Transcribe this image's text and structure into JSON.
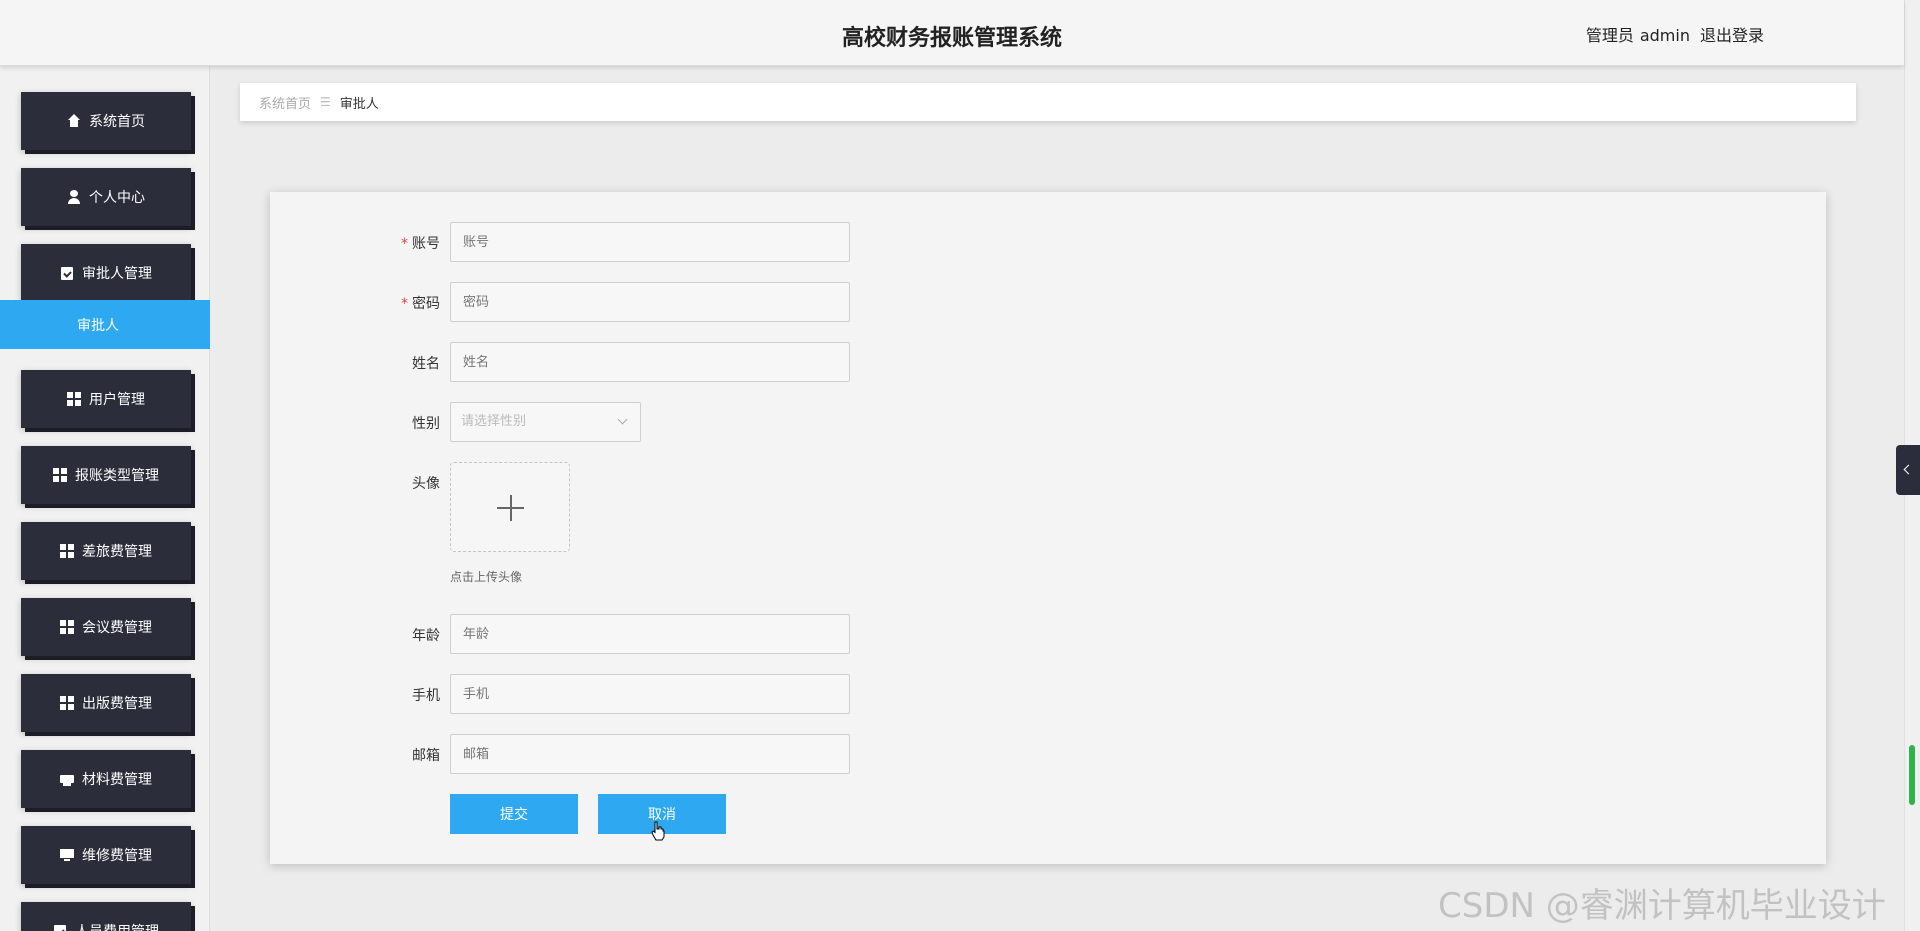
{
  "header": {
    "title": "高校财务报账管理系统",
    "role": "管理员",
    "username": "admin",
    "logout": "退出登录"
  },
  "sidebar": {
    "items": [
      {
        "label": "系统首页",
        "icon": "home-icon"
      },
      {
        "label": "个人中心",
        "icon": "user-icon"
      },
      {
        "label": "审批人管理",
        "icon": "clipboard-icon"
      },
      {
        "label": "用户管理",
        "icon": "grid-icon"
      },
      {
        "label": "报账类型管理",
        "icon": "grid-icon"
      },
      {
        "label": "差旅费管理",
        "icon": "grid-icon"
      },
      {
        "label": "会议费管理",
        "icon": "grid-icon"
      },
      {
        "label": "出版费管理",
        "icon": "grid-icon"
      },
      {
        "label": "材料费管理",
        "icon": "printer-icon"
      },
      {
        "label": "维修费管理",
        "icon": "monitor-icon"
      },
      {
        "label": "人员费用管理",
        "icon": "clipboard-icon"
      }
    ],
    "active_sub": "审批人"
  },
  "breadcrumb": {
    "home": "系统首页",
    "separator": "☰",
    "current": "审批人"
  },
  "form": {
    "account": {
      "label": "账号",
      "required": true,
      "placeholder": "账号"
    },
    "password": {
      "label": "密码",
      "required": true,
      "placeholder": "密码"
    },
    "name": {
      "label": "姓名",
      "placeholder": "姓名"
    },
    "gender": {
      "label": "性别",
      "placeholder": "请选择性别"
    },
    "avatar": {
      "label": "头像",
      "hint": "点击上传头像"
    },
    "age": {
      "label": "年龄",
      "placeholder": "年龄"
    },
    "phone": {
      "label": "手机",
      "placeholder": "手机"
    },
    "email": {
      "label": "邮箱",
      "placeholder": "邮箱"
    },
    "submit": "提交",
    "cancel": "取消",
    "required_mark": "*"
  },
  "watermark": "CSDN @睿渊计算机毕业设计",
  "colors": {
    "sidebar_btn": "#2b2d3a",
    "accent": "#2ea8f0",
    "required": "#e0463f"
  }
}
